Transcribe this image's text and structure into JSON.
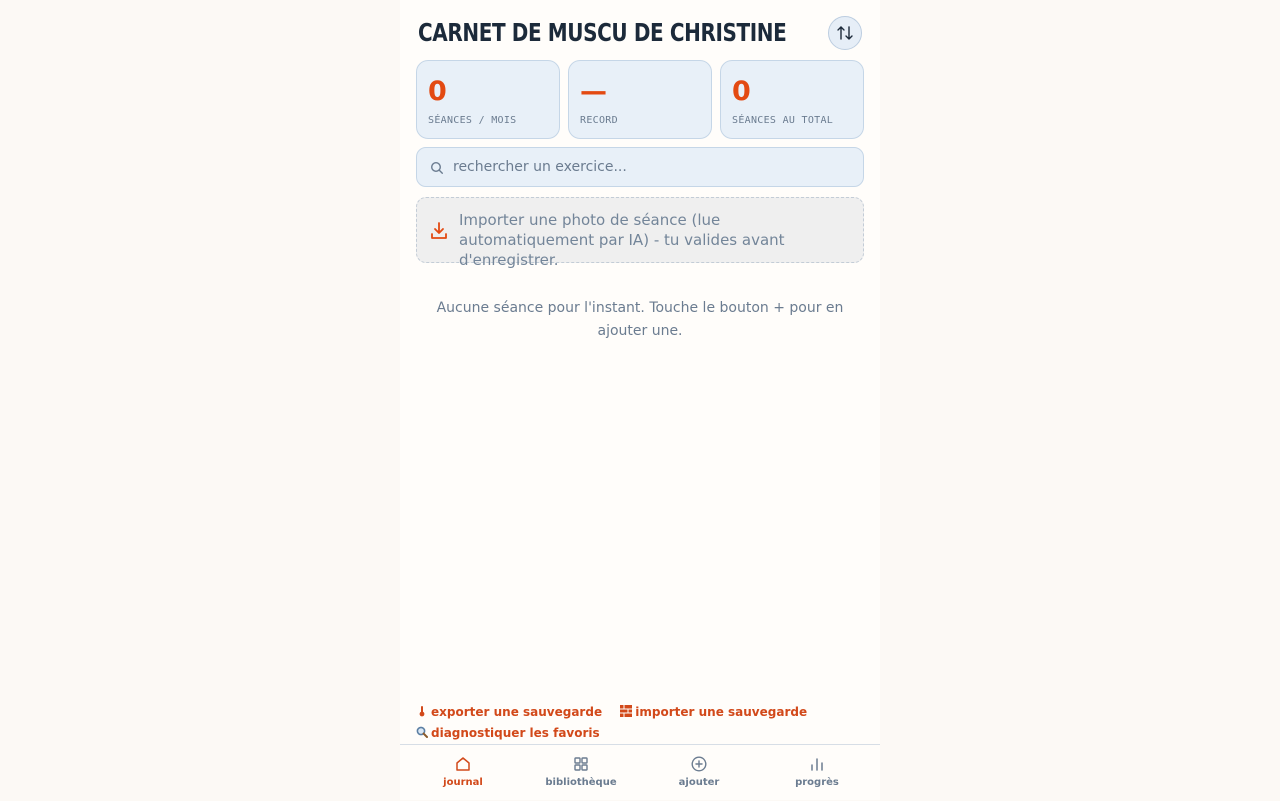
{
  "header": {
    "title": "CARNET DE MUSCU DE CHRISTINE",
    "sort_icon": "sort-arrows-icon"
  },
  "stats": [
    {
      "value": "0",
      "label": "SÉANCES / MOIS"
    },
    {
      "value": "—",
      "label": "RECORD"
    },
    {
      "value": "0",
      "label": "SÉANCES AU TOTAL"
    }
  ],
  "search": {
    "placeholder": "rechercher un exercice..."
  },
  "import_photo": {
    "text": "Importer une photo de séance (lue automatiquement par IA) - tu valides avant d'enregistrer."
  },
  "empty_state": {
    "text": "Aucune séance pour l'instant. Touche le bouton + pour en ajouter une."
  },
  "backup": {
    "export_label": "exporter une sauvegarde",
    "import_label": "importer une sauvegarde",
    "diagnose_label": "diagnostiquer les favoris"
  },
  "nav": [
    {
      "label": "journal",
      "icon": "home-icon",
      "active": true
    },
    {
      "label": "bibliothèque",
      "icon": "grid-icon",
      "active": false
    },
    {
      "label": "ajouter",
      "icon": "plus-circle-icon",
      "active": false
    },
    {
      "label": "progrès",
      "icon": "bar-chart-icon",
      "active": false
    }
  ],
  "colors": {
    "accent": "#e34a12",
    "muted": "#6b7c90",
    "card_bg": "#e8f0f8"
  }
}
